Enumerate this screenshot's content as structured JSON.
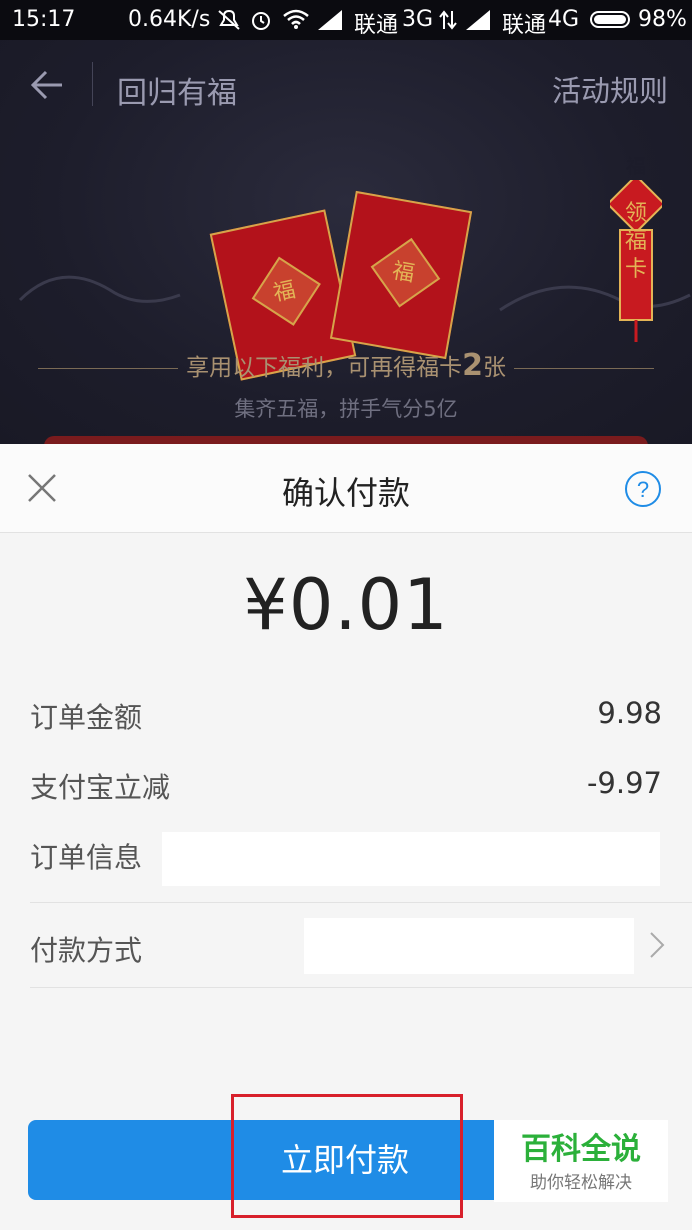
{
  "status_bar": {
    "time": "15:17",
    "speed": "0.64K/s",
    "carrier1": "联通",
    "net1": "3G",
    "carrier2": "联通",
    "net2": "4G",
    "battery": "98%"
  },
  "header": {
    "title": "回归有福",
    "rules_link": "活动规则",
    "charm_text": [
      "福",
      "领",
      "福",
      "卡"
    ],
    "envelope_char": "福",
    "benefit_prefix": "享用以下福利，可再得福卡",
    "benefit_count": "2",
    "benefit_suffix": "张",
    "subtitle": "集齐五福，拼手气分5亿"
  },
  "dialog": {
    "title": "确认付款",
    "amount": "¥0.01",
    "rows": [
      {
        "label": "订单金额",
        "value": "9.98"
      },
      {
        "label": "支付宝立减",
        "value": "-9.97"
      },
      {
        "label": "订单信息",
        "value": ""
      },
      {
        "label": "付款方式",
        "value": ""
      }
    ],
    "pay_button": "立即付款"
  },
  "watermark": {
    "title": "百科全说",
    "subtitle": "助你轻松解决"
  },
  "colors": {
    "accent_blue": "#1f8ce6",
    "highlight_red": "#d8202b",
    "envelope_red": "#b3121b",
    "watermark_green": "#2bb03a"
  }
}
